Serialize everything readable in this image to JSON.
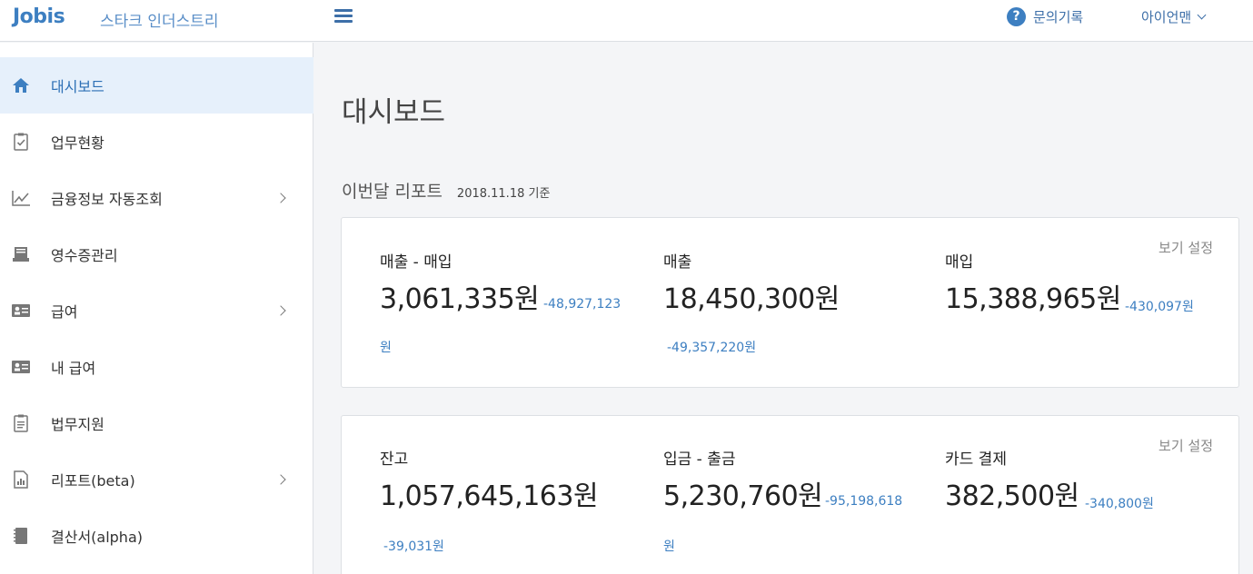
{
  "header": {
    "logo": "Jobis",
    "company": "스타크 인더스트리",
    "help_label": "문의기록",
    "user_label": "아이언맨",
    "accent": "#3d7fc1"
  },
  "sidebar": {
    "items": [
      {
        "label": "대시보드",
        "icon": "home-icon",
        "active": true
      },
      {
        "label": "업무현황",
        "icon": "clipboard-check-icon"
      },
      {
        "label": "금융정보 자동조회",
        "icon": "line-chart-icon",
        "has_children": true
      },
      {
        "label": "영수증관리",
        "icon": "receipt-icon"
      },
      {
        "label": "급여",
        "icon": "id-card-icon",
        "has_children": true
      },
      {
        "label": "내 급여",
        "icon": "id-card-icon"
      },
      {
        "label": "법무지원",
        "icon": "clipboard-icon"
      },
      {
        "label": "리포트(beta)",
        "icon": "report-icon",
        "has_children": true
      },
      {
        "label": "결산서(alpha)",
        "icon": "book-icon"
      }
    ]
  },
  "main": {
    "page_title": "대시보드",
    "report_title": "이번달 리포트",
    "report_date": "2018.11.18 기준",
    "view_setting_label": "보기 설정",
    "card1": [
      {
        "label": "매출 - 매입",
        "value": "3,061,335원",
        "delta_line1": "-48,927,123",
        "delta_line2": "원"
      },
      {
        "label": "매출",
        "value": "18,450,300원",
        "delta_line1": "",
        "delta_line2": "-49,357,220원"
      },
      {
        "label": "매입",
        "value": "15,388,965원",
        "delta_line1": "-430,097원",
        "delta_line2": ""
      }
    ],
    "card2": [
      {
        "label": "잔고",
        "value": "1,057,645,163원",
        "delta_line1": "",
        "delta_line2": "-39,031원"
      },
      {
        "label": "입금 - 출금",
        "value": "5,230,760원",
        "delta_line1": "-95,198,618",
        "delta_line2": "원"
      },
      {
        "label": "카드 결제",
        "value": "382,500원",
        "delta_line1": "-340,800원",
        "delta_line2": ""
      }
    ]
  }
}
